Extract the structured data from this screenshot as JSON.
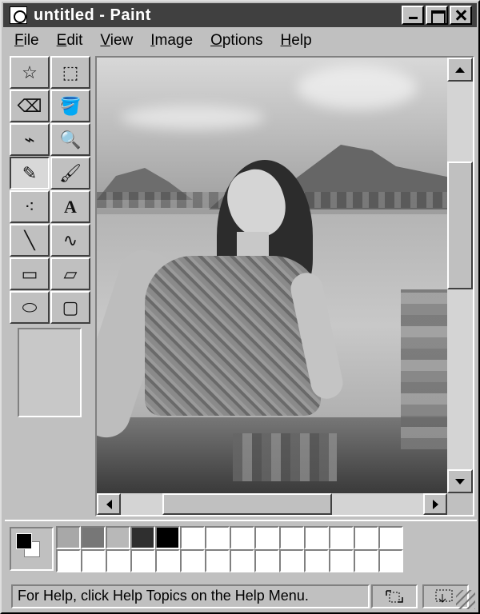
{
  "window": {
    "title": "untitled - Paint",
    "title_buttons": [
      "minimize",
      "maximize",
      "close"
    ]
  },
  "menu": {
    "items": [
      {
        "label": "File",
        "underline_index": 0
      },
      {
        "label": "Edit",
        "underline_index": 0
      },
      {
        "label": "View",
        "underline_index": 0
      },
      {
        "label": "Image",
        "underline_index": 0
      },
      {
        "label": "Options",
        "underline_index": 0
      },
      {
        "label": "Help",
        "underline_index": 0
      }
    ]
  },
  "toolbox": {
    "tools": [
      {
        "name": "free-form-select",
        "icon": "free-form-select-icon",
        "glyph": "☆",
        "active": false
      },
      {
        "name": "select",
        "icon": "rectangle-select-icon",
        "glyph": "⬚",
        "active": false
      },
      {
        "name": "eraser",
        "icon": "eraser-icon",
        "glyph": "⌫",
        "active": false
      },
      {
        "name": "fill-with-color",
        "icon": "paint-bucket-icon",
        "glyph": "🪣",
        "active": false
      },
      {
        "name": "pick-color",
        "icon": "eyedropper-icon",
        "glyph": "⌁",
        "active": false
      },
      {
        "name": "magnifier",
        "icon": "magnifier-icon",
        "glyph": "🔍",
        "active": false
      },
      {
        "name": "pencil",
        "icon": "pencil-icon",
        "glyph": "✎",
        "active": true
      },
      {
        "name": "brush",
        "icon": "brush-icon",
        "glyph": "🖌",
        "active": false
      },
      {
        "name": "airbrush",
        "icon": "airbrush-icon",
        "glyph": "⁖",
        "active": false
      },
      {
        "name": "text",
        "icon": "text-icon",
        "glyph": "A",
        "active": false
      },
      {
        "name": "line",
        "icon": "line-icon",
        "glyph": "╲",
        "active": false
      },
      {
        "name": "curve",
        "icon": "curve-icon",
        "glyph": "∿",
        "active": false
      },
      {
        "name": "rectangle",
        "icon": "rectangle-icon",
        "glyph": "▭",
        "active": false
      },
      {
        "name": "polygon",
        "icon": "polygon-icon",
        "glyph": "▱",
        "active": false
      },
      {
        "name": "ellipse",
        "icon": "ellipse-icon",
        "glyph": "⬭",
        "active": false
      },
      {
        "name": "rounded-rectangle",
        "icon": "rounded-rectangle-icon",
        "glyph": "▢",
        "active": false
      }
    ]
  },
  "canvas": {
    "image_description_id": "blurred-photo",
    "background": "#aaaaaa"
  },
  "palette": {
    "foreground": "#000000",
    "background": "#ffffff",
    "swatches": [
      "#a8a8a8",
      "#777777",
      "#b8b8b8",
      "#2f2f2f",
      "#000000",
      "#ffffff",
      "#ffffff",
      "#ffffff",
      "#ffffff",
      "#ffffff",
      "#ffffff",
      "#ffffff",
      "#ffffff",
      "#ffffff",
      "#ffffff",
      "#ffffff",
      "#ffffff",
      "#ffffff",
      "#ffffff",
      "#ffffff",
      "#ffffff",
      "#ffffff",
      "#ffffff",
      "#ffffff",
      "#ffffff",
      "#ffffff",
      "#ffffff",
      "#ffffff"
    ]
  },
  "status": {
    "help_text": "For Help, click Help Topics on the Help Menu."
  }
}
